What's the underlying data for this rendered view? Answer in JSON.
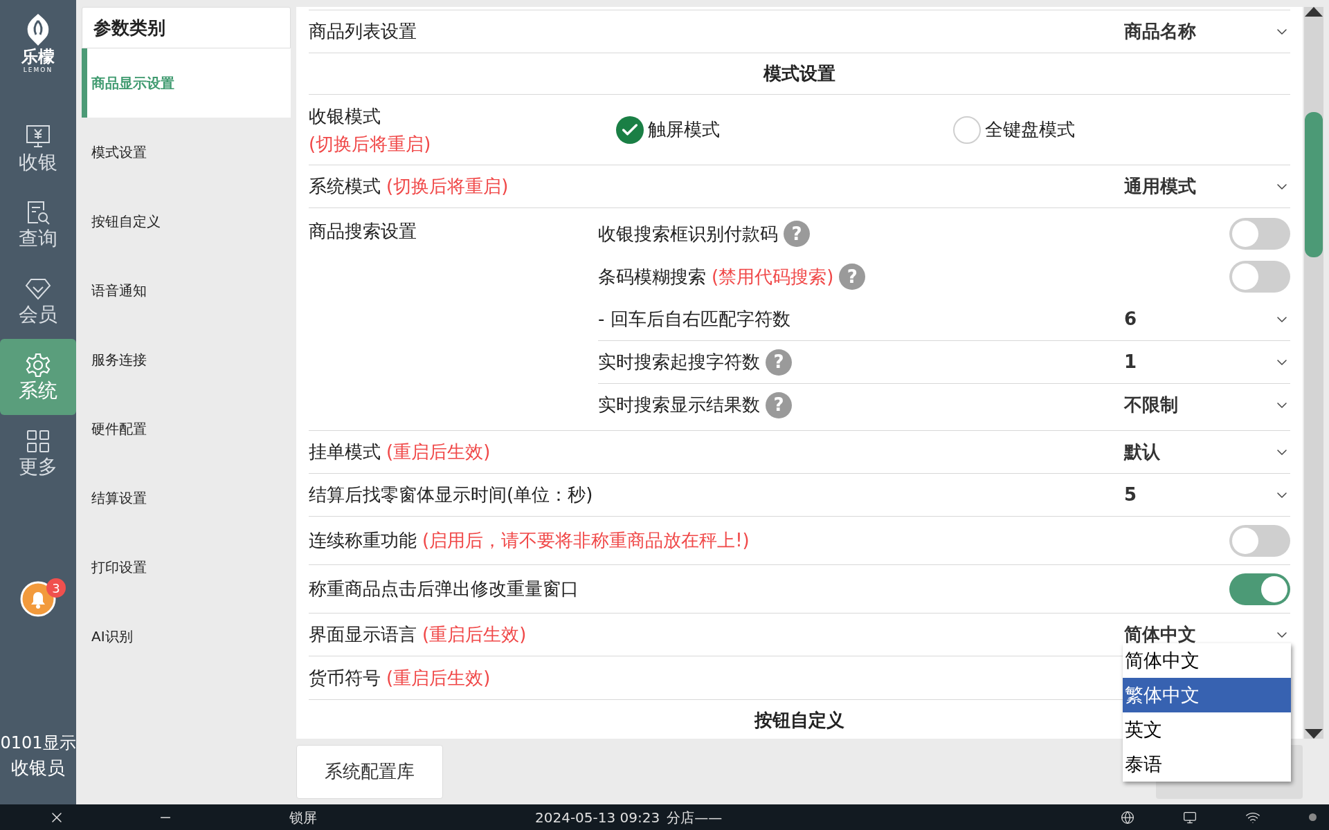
{
  "nav": {
    "logo_text": "乐檬",
    "logo_subtext": "LEMON",
    "items": [
      {
        "label": "收银",
        "selected": false
      },
      {
        "label": "查询",
        "selected": false
      },
      {
        "label": "会员",
        "selected": false
      },
      {
        "label": "系统",
        "selected": true
      },
      {
        "label": "更多",
        "selected": false
      }
    ],
    "notification_count": "3",
    "user_line1": "0101显示",
    "user_line2": "收银员"
  },
  "categories": {
    "title": "参数类别",
    "items": [
      {
        "label": "商品显示设置",
        "selected": true
      },
      {
        "label": "模式设置",
        "selected": false
      },
      {
        "label": "按钮自定义",
        "selected": false
      },
      {
        "label": "语音通知",
        "selected": false
      },
      {
        "label": "服务连接",
        "selected": false
      },
      {
        "label": "硬件配置",
        "selected": false
      },
      {
        "label": "结算设置",
        "selected": false
      },
      {
        "label": "打印设置",
        "selected": false
      },
      {
        "label": "AI识别",
        "selected": false
      }
    ]
  },
  "settings": [
    {
      "kind": "select",
      "label": "商品列表设置",
      "value": "商品名称"
    },
    {
      "kind": "section",
      "label": "模式设置"
    },
    {
      "kind": "radio",
      "label": "收银模式",
      "note": "(切换后将重启)",
      "options": [
        {
          "label": "触屏模式",
          "selected": true
        },
        {
          "label": "全键盘模式",
          "selected": false
        }
      ]
    },
    {
      "kind": "select",
      "label": "系统模式",
      "note": "(切换后将重启)",
      "value": "通用模式"
    },
    {
      "kind": "group",
      "label": "商品搜索设置",
      "children": [
        {
          "kind": "toggle",
          "label": "收银搜索框识别付款码",
          "help": "?",
          "on": false
        },
        {
          "kind": "toggle",
          "label": "条码模糊搜索",
          "note": "(禁用代码搜索)",
          "help": "?",
          "on": false
        },
        {
          "kind": "select",
          "label": "- 回车后自右匹配字符数",
          "value": "6"
        },
        {
          "kind": "select",
          "label": "实时搜索起搜字符数",
          "help": "?",
          "value": "1"
        },
        {
          "kind": "select",
          "label": "实时搜索显示结果数",
          "help": "?",
          "value": "不限制"
        }
      ]
    },
    {
      "kind": "select",
      "label": "挂单模式",
      "note": "(重启后生效)",
      "value": "默认"
    },
    {
      "kind": "select",
      "label": "结算后找零窗体显示时间(单位：秒)",
      "value": "5"
    },
    {
      "kind": "toggle",
      "label": "连续称重功能",
      "note": "(启用后，请不要将非称重商品放在秤上!)",
      "on": false
    },
    {
      "kind": "toggle",
      "label": "称重商品点击后弹出修改重量窗口",
      "on": true
    },
    {
      "kind": "select",
      "label": "界面显示语言",
      "note": "(重启后生效)",
      "value": "简体中文"
    },
    {
      "kind": "covered",
      "label": "货币符号",
      "note": "(重启后生效)"
    },
    {
      "kind": "section",
      "label": "按钮自定义"
    }
  ],
  "dropdown": {
    "options": [
      {
        "label": "简体中文",
        "selected": false
      },
      {
        "label": "繁体中文",
        "selected": true
      },
      {
        "label": "英文",
        "selected": false
      },
      {
        "label": "泰语",
        "selected": false
      }
    ]
  },
  "footer": {
    "buttons": [
      "系统配置库"
    ]
  },
  "taskbar": {
    "lock": "锁屏",
    "datetime": "2024-05-13 09:23",
    "store": "分店——"
  }
}
